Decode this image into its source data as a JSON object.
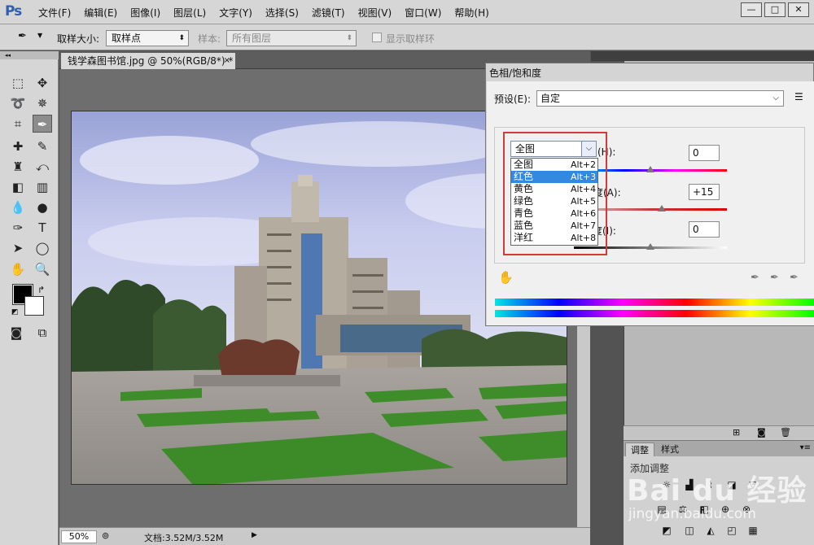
{
  "app": {
    "logo": "Ps",
    "menus": [
      "文件(F)",
      "编辑(E)",
      "图像(I)",
      "图层(L)",
      "文字(Y)",
      "选择(S)",
      "滤镜(T)",
      "视图(V)",
      "窗口(W)",
      "帮助(H)"
    ],
    "window_controls": {
      "minimize": "—",
      "maximize": "□",
      "close": "✕"
    }
  },
  "options_bar": {
    "sample_size_label": "取样大小:",
    "sample_size_value": "取样点",
    "sample_label": "样本:",
    "sample_value": "所有图层",
    "show_ring_label": "显示取样环"
  },
  "document": {
    "tab_title": "钱学森图书馆.jpg @ 50%(RGB/8*) *",
    "tab_close": "×",
    "zoom": "50%",
    "doc_info": "文档:3.52M/3.52M"
  },
  "dialog": {
    "title": "色相/饱和度",
    "preset_label": "预设(E):",
    "preset_value": "自定",
    "channel_value": "全图",
    "channel_options": [
      {
        "label": "全图",
        "shortcut": "Alt+2"
      },
      {
        "label": "红色",
        "shortcut": "Alt+3"
      },
      {
        "label": "黄色",
        "shortcut": "Alt+4"
      },
      {
        "label": "绿色",
        "shortcut": "Alt+5"
      },
      {
        "label": "青色",
        "shortcut": "Alt+6"
      },
      {
        "label": "蓝色",
        "shortcut": "Alt+7"
      },
      {
        "label": "洋红",
        "shortcut": "Alt+8"
      }
    ],
    "selected_option": 1,
    "hue_label_tail": "(H):",
    "hue_value": "0",
    "hue_level": 0.5,
    "saturation_label_tail": "度(A):",
    "saturation_value": "+15",
    "saturation_level": 0.575,
    "lightness_label_tail": "明度(I):",
    "lightness_value": "0",
    "lightness_level": 0.5
  },
  "panels": {
    "adjust_tab": "调整",
    "style_tab": "样式",
    "adjust_title": "添加调整"
  },
  "watermark": {
    "text": "Bai du 经验",
    "url": "jingyan.baidu.com"
  },
  "colors": {
    "selection_blue": "#3388e0",
    "highlight_red": "#d33a3a",
    "foreground": "#000000",
    "background": "#ffffff"
  }
}
